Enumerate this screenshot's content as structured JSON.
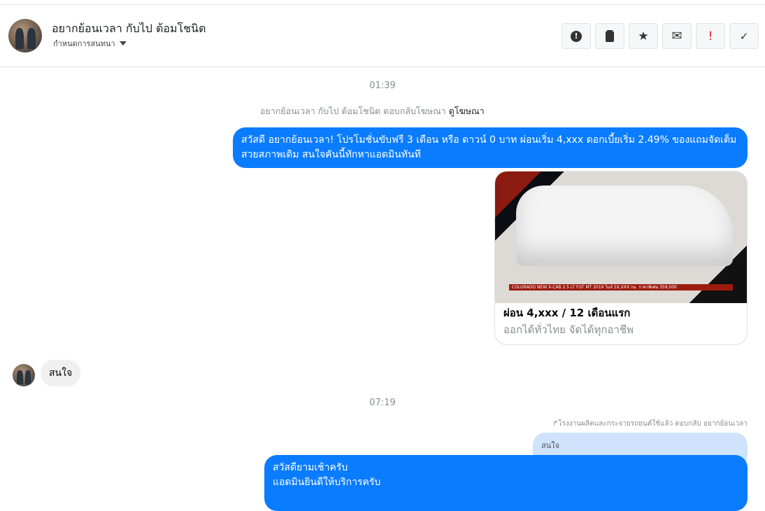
{
  "header": {
    "title": "อยากย้อนเวลา กับไป ต้อมโชนิต",
    "subtitle": "กำหนดการสนทนา",
    "actions": [
      {
        "name": "spam-button",
        "icon": "●!"
      },
      {
        "name": "delete-button",
        "icon": "🗑"
      },
      {
        "name": "star-button",
        "icon": "★"
      },
      {
        "name": "mark-unread-button",
        "icon": "✉"
      },
      {
        "name": "important-button",
        "icon": "!"
      },
      {
        "name": "done-button",
        "icon": "✓"
      }
    ]
  },
  "messages": {
    "time1": "01:39",
    "ad_reply_text": "อยากย้อนเวลา กับไป ต้อมโชนิต ตอบกลับโฆษณา",
    "ad_link": "ดูโฆษณา",
    "outgoing1": "สวัสดี อยากย้อนเวลา! โปรโมชั่นขับฟรี 3 เดือน หรือ ดาวน์ 0 บาท ผ่อนเริ่ม 4,xxx ดอกเบี้ยเริ่ม 2.49% ของแถมจัดเต็ม สวยสภาพเดิม สนใจคันนี้ทักหาแอดมินทันที",
    "card": {
      "image_caption": "COLORADO NEW X-CAB 2.5 LT FGT MT 2019 ไมล์ 5X,XXX กม. ราคาพิเศษ 359,000",
      "title": "ผ่อน 4,xxx / 12 เดือนแรก",
      "subtitle": "ออกได้ทั่วไทย จัดได้ทุกอาชีพ"
    },
    "incoming1": "สนใจ",
    "time2": "07:19",
    "reply_context": "↱โรงงานผลิตและกระจายรถยนต์ใช้แล้ว ตอบกลับ อยากย้อนเวลา",
    "quoted": "สนใจ",
    "outgoing2_line1": "สวัสดียามเช้าครับ",
    "outgoing2_line2": "แอดมินยินดีให้บริการครับ"
  },
  "colors": {
    "accent": "#0a7cff",
    "quoted_bg": "#cfe3fc",
    "important": "#e02020"
  }
}
